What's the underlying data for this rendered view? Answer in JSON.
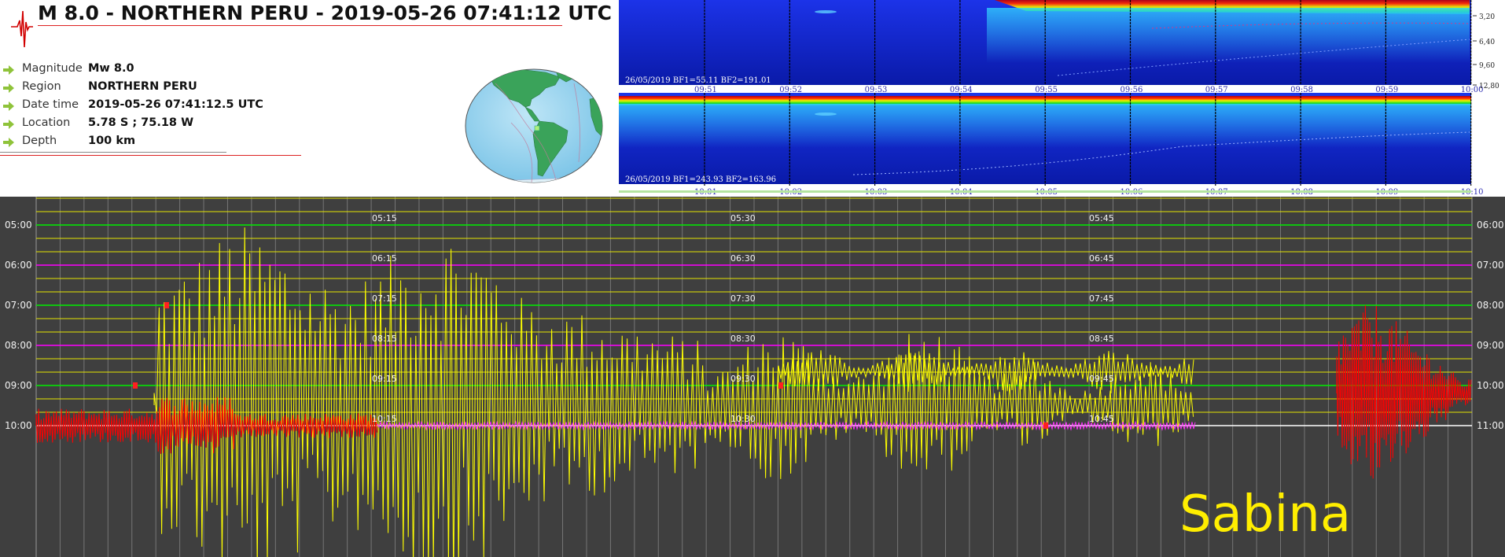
{
  "event": {
    "title": "M 8.0 - NORTHERN PERU - 2019-05-26 07:41:12 UTC",
    "details": [
      {
        "label": "Magnitude",
        "value": "Mw 8.0"
      },
      {
        "label": "Region",
        "value": "NORTHERN PERU"
      },
      {
        "label": "Date time",
        "value": "2019-05-26 07:41:12.5 UTC"
      },
      {
        "label": "Location",
        "value": "5.78 S ; 75.18 W"
      },
      {
        "label": "Depth",
        "value": "100 km"
      }
    ],
    "icons": [
      "seismogram-logo-icon",
      "arrow-bullet-icon",
      "globe-map-icon"
    ]
  },
  "spectrogram": {
    "top": {
      "caption": "26/05/2019 BF1=55.11 BF2=191.01",
      "times": [
        "09:51",
        "09:52",
        "09:53",
        "09:54",
        "09:55",
        "09:56",
        "09:57",
        "09:58",
        "09:59",
        "10:00"
      ],
      "freq_labels": [
        "3,20",
        "6,40",
        "9,60",
        "12,80"
      ]
    },
    "bottom": {
      "caption": "26/05/2019 BF1=243.93 BF2=163.96",
      "times": [
        "10:01",
        "10:02",
        "10:03",
        "10:04",
        "10:05",
        "10:06",
        "10:07",
        "10:08",
        "10:09",
        "10:10"
      ]
    }
  },
  "helicorder": {
    "station": "Sabina",
    "left_hours": [
      "05:00",
      "06:00",
      "07:00",
      "08:00",
      "09:00",
      "10:00"
    ],
    "right_hours": [
      "06:00",
      "07:00",
      "08:00",
      "09:00",
      "10:00",
      "11:00"
    ],
    "minute_marks": [
      [
        "05:15",
        "05:30",
        "05:45"
      ],
      [
        "06:15",
        "06:30",
        "06:45"
      ],
      [
        "07:15",
        "07:30",
        "07:45"
      ],
      [
        "08:15",
        "08:30",
        "08:45"
      ],
      [
        "09:15",
        "09:30",
        "09:45"
      ],
      [
        "10:15",
        "10:30",
        "10:45"
      ]
    ],
    "trace_color": "#ffff00",
    "event_color": "#ff0000",
    "hour_line_colors": [
      "#00ee00",
      "#ff00ff",
      "#00ee00",
      "#ff00ff",
      "#00ee00",
      "#ffffff"
    ]
  }
}
